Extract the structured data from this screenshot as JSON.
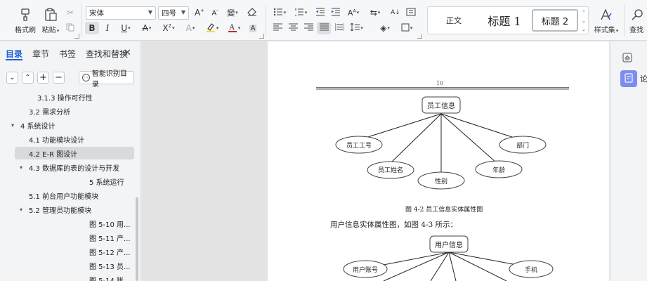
{
  "ribbon": {
    "format_painter": "格式刷",
    "paste": "粘贴",
    "font_name": "宋体",
    "font_size": "四号",
    "styles": [
      {
        "label": "正文",
        "selected": false
      },
      {
        "label": "标题 1",
        "selected": false
      },
      {
        "label": "标题 2",
        "selected": true
      }
    ],
    "style_set": "样式集",
    "find": "查找",
    "colors": {
      "highlight": "#f4e21c",
      "font_color": "#d32020"
    }
  },
  "nav": {
    "tabs": [
      "目录",
      "章节",
      "书签",
      "查找和替换"
    ],
    "active_tab": 0,
    "smart_button": "智能识别目录",
    "items": [
      {
        "label": "3.1.3 操作可行性",
        "level": 3,
        "toggle": "",
        "selected": false
      },
      {
        "label": "3.2 需求分析",
        "level": 2,
        "toggle": "",
        "selected": false
      },
      {
        "label": "4 系统设计",
        "level": 1,
        "toggle": "▾",
        "selected": false
      },
      {
        "label": "4.1 功能模块设计",
        "level": 2,
        "toggle": "",
        "selected": false
      },
      {
        "label": "4.2 E-R 图设计",
        "level": 2,
        "toggle": "",
        "selected": true
      },
      {
        "label": "4.3 数据库的表的设计与开发",
        "level": 2,
        "toggle": "▾",
        "selected": false
      },
      {
        "label": "5 系统运行",
        "level": 4,
        "toggle": "",
        "selected": false
      },
      {
        "label": "5.1 前台用户功能模块",
        "level": 2,
        "toggle": "",
        "selected": false
      },
      {
        "label": "5.2 管理员功能模块",
        "level": 2,
        "toggle": "▾",
        "selected": false
      },
      {
        "label": "图 5-10 用...",
        "level": 4,
        "toggle": "",
        "selected": false
      },
      {
        "label": "图 5-11 产...",
        "level": 4,
        "toggle": "",
        "selected": false
      },
      {
        "label": "图 5-12 产...",
        "level": 4,
        "toggle": "",
        "selected": false
      },
      {
        "label": "图 5-13 员...",
        "level": 4,
        "toggle": "",
        "selected": false
      },
      {
        "label": "图 5-14 账...",
        "level": 4,
        "toggle": "",
        "selected": false
      }
    ]
  },
  "document": {
    "header_page_number": "10",
    "er1": {
      "entity": "员工信息",
      "attributes": [
        "员工工号",
        "员工姓名",
        "性别",
        "年龄",
        "部门"
      ]
    },
    "caption1": "图 4-2 员工信息实体属性图",
    "paragraph": "用户信息实体属性图，如图 4-3 所示：",
    "er2": {
      "entity": "用户信息",
      "attributes": [
        "用户账号",
        "手机"
      ]
    }
  },
  "right_panel": {
    "label": "论"
  }
}
